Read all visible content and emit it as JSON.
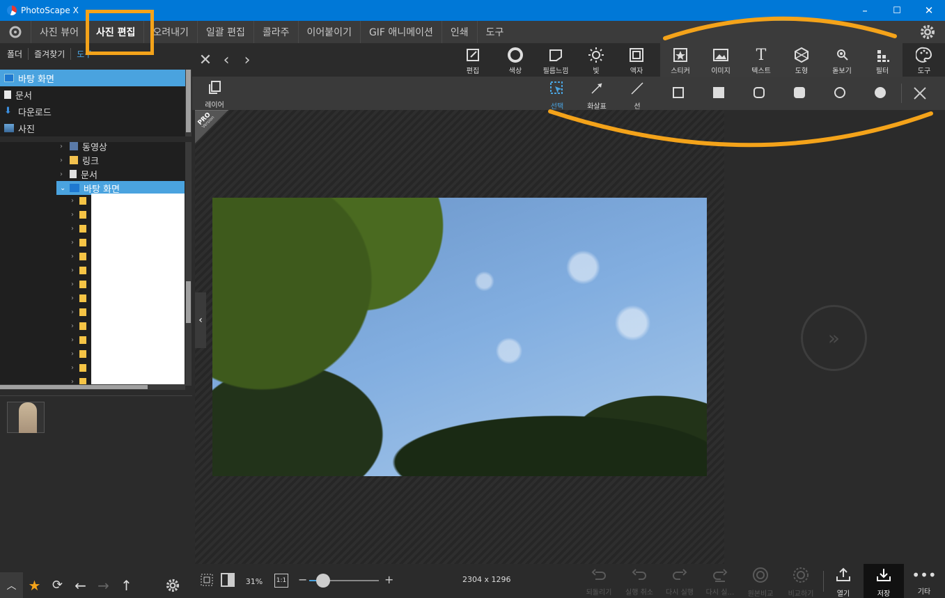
{
  "window": {
    "title": "PhotoScape X",
    "controls": [
      "–",
      "☐",
      "✕"
    ]
  },
  "menu": {
    "items": [
      "사진 뷰어",
      "사진 편집",
      "오려내기",
      "일괄 편집",
      "콜라주",
      "이어붙이기",
      "GIF 애니메이션",
      "인쇄",
      "도구"
    ],
    "active_index": 1
  },
  "left": {
    "tabs": [
      "폴더",
      "즐겨찾기",
      "도구"
    ],
    "quick": [
      "바탕 화면",
      "문서",
      "다운로드",
      "사진"
    ],
    "tree": {
      "partial": "동영상",
      "links": "링크",
      "docs": "문서",
      "desktop": "바탕 화면"
    }
  },
  "toolbar": {
    "tools": [
      "편집",
      "색상",
      "필름느낌",
      "빛",
      "액자",
      "스티커",
      "이미지",
      "텍스트",
      "도형",
      "돋보기",
      "필터",
      "도구"
    ]
  },
  "subtoolbar": {
    "layer": "레이어",
    "tools": [
      "선택",
      "화살표",
      "선"
    ],
    "active": "선택"
  },
  "badge": {
    "pro": "PRO",
    "version": "Version"
  },
  "bottom": {
    "zoom": "31%",
    "one_to_one": "1:1",
    "dimensions": "2304 x 1296",
    "actions": [
      "되돌리기",
      "실행 취소",
      "다시 실행",
      "다시 실…",
      "원본비교",
      "비교하기",
      "열기",
      "저장",
      "기타"
    ]
  },
  "colors": {
    "accent": "#4aa3df",
    "titlebar": "#0078d7",
    "highlight": "#f4a31a"
  }
}
